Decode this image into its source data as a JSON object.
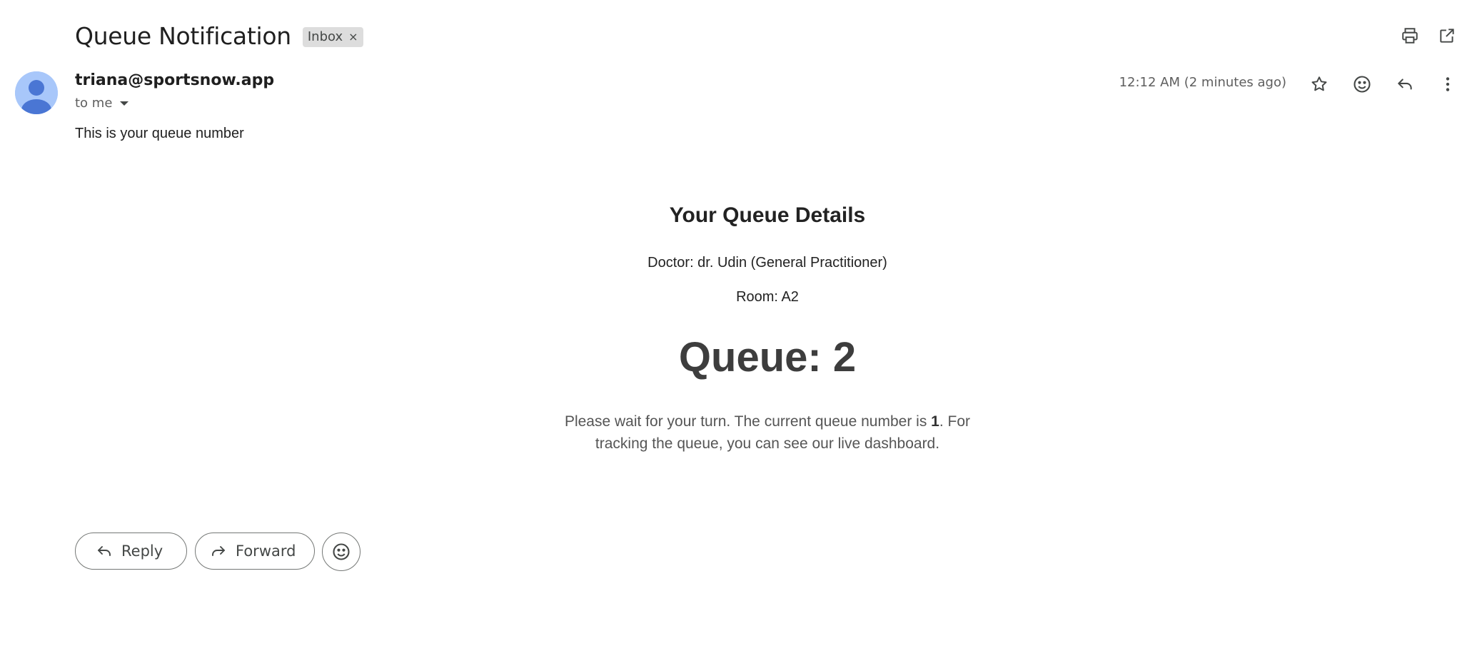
{
  "email": {
    "subject": "Queue Notification",
    "label": "Inbox",
    "label_remove": "×",
    "sender": "triana@sportsnow.app",
    "recipient_line": "to me",
    "timestamp": "12:12 AM (2 minutes ago)",
    "snippet": "This is your queue number"
  },
  "toolbar": {
    "icons": [
      "print-icon",
      "open-in-new-window-icon",
      "star-icon",
      "emoji-icon",
      "reply-icon",
      "more-vert-icon"
    ]
  },
  "body": {
    "title": "Your Queue Details",
    "doctor": "Doctor: dr. Udin (General Practitioner)",
    "room": "Room: A2",
    "queue": "Queue: 2",
    "wait_prefix": "Please wait for your turn. The current queue number is ",
    "current_number": "1",
    "wait_suffix_line1": ". For",
    "wait_line2": "tracking the queue, you can see our live dashboard."
  },
  "actions": {
    "reply_label": "Reply",
    "forward_label": "Forward"
  },
  "colors": {
    "avatar_bg": "#a8c7fa",
    "avatar_fg": "#4a76d4",
    "chip_bg": "#dddddd"
  }
}
